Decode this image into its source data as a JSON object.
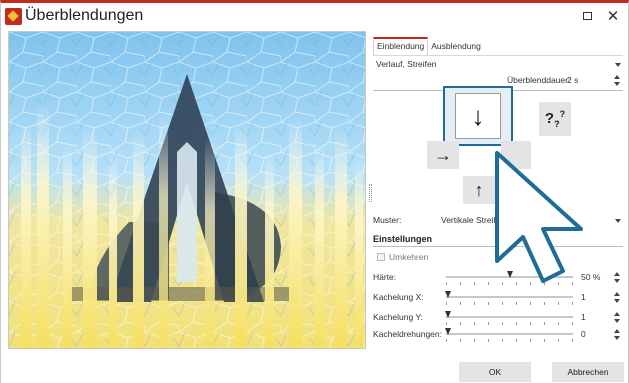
{
  "window": {
    "title": "Überblendungen"
  },
  "tabs": [
    {
      "label": "Einblendung",
      "active": true
    },
    {
      "label": "Ausblendung",
      "active": false
    }
  ],
  "transition": {
    "selected": "Verlauf, Streifen"
  },
  "duration": {
    "label": "Überblenddauer:",
    "value": "2 s"
  },
  "directions": {
    "up": "↑",
    "down": "↓",
    "right": "→",
    "random": "?"
  },
  "muster": {
    "label": "Muster:",
    "value": "Vertikale Streif"
  },
  "settings": {
    "heading": "Einstellungen",
    "reverse_label": "Umkehren",
    "reverse_checked": false,
    "params": [
      {
        "label": "Härte:",
        "value": "50 %",
        "level": 0.5
      },
      {
        "label": "Kachelung X:",
        "value": "1",
        "level": 0.0
      },
      {
        "label": "Kachelung Y:",
        "value": "1",
        "level": 0.0
      },
      {
        "label": "Kacheldrehungen:",
        "value": "0",
        "level": 0.0
      }
    ]
  },
  "footer": {
    "ok": "OK",
    "cancel": "Abbrechen"
  },
  "icons": [
    "app-icon",
    "maximize-icon",
    "close-icon",
    "arrow-down-icon",
    "arrow-right-icon",
    "arrow-up-icon",
    "question-icon",
    "mouse-pointer-icon"
  ],
  "colors": {
    "accent": "#c42a1c",
    "selection": "#1f6c96",
    "preview_sky": "#8fcdf0",
    "preview_sand": "#f3e48a",
    "logo": "#2b3e52"
  }
}
